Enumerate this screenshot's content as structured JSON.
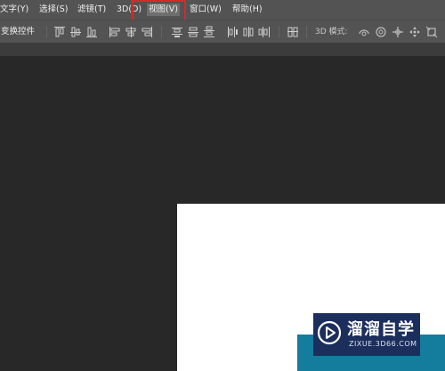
{
  "menubar": {
    "items": [
      {
        "label": "文字(Y)"
      },
      {
        "label": "选择(S)"
      },
      {
        "label": "滤镜(T)"
      },
      {
        "label": "3D(D)"
      },
      {
        "label": "视图(V)"
      },
      {
        "label": "窗口(W)"
      },
      {
        "label": "帮助(H)"
      }
    ],
    "highlight_color": "#d22b2b"
  },
  "optionsbar": {
    "transform_label": "变换控件",
    "mode3d_label": "3D 模式:",
    "icons": [
      "align-top-edges-icon",
      "align-vertical-centers-icon",
      "align-bottom-edges-icon",
      "align-left-edges-icon",
      "align-horizontal-centers-icon",
      "align-right-edges-icon",
      "distribute-top-icon",
      "distribute-vertical-centers-icon",
      "distribute-bottom-icon",
      "distribute-left-icon",
      "distribute-horizontal-centers-icon",
      "distribute-right-icon",
      "auto-align-layers-icon",
      "rotate-3d-icon",
      "roll-3d-icon",
      "drag-3d-icon",
      "slide-3d-icon",
      "scale-3d-icon"
    ]
  },
  "watermark": {
    "title": "溜溜自学",
    "url": "ZIXUE.3D66.COM",
    "bar_color": "#147d9e",
    "box_color": "#1c2e5c"
  }
}
